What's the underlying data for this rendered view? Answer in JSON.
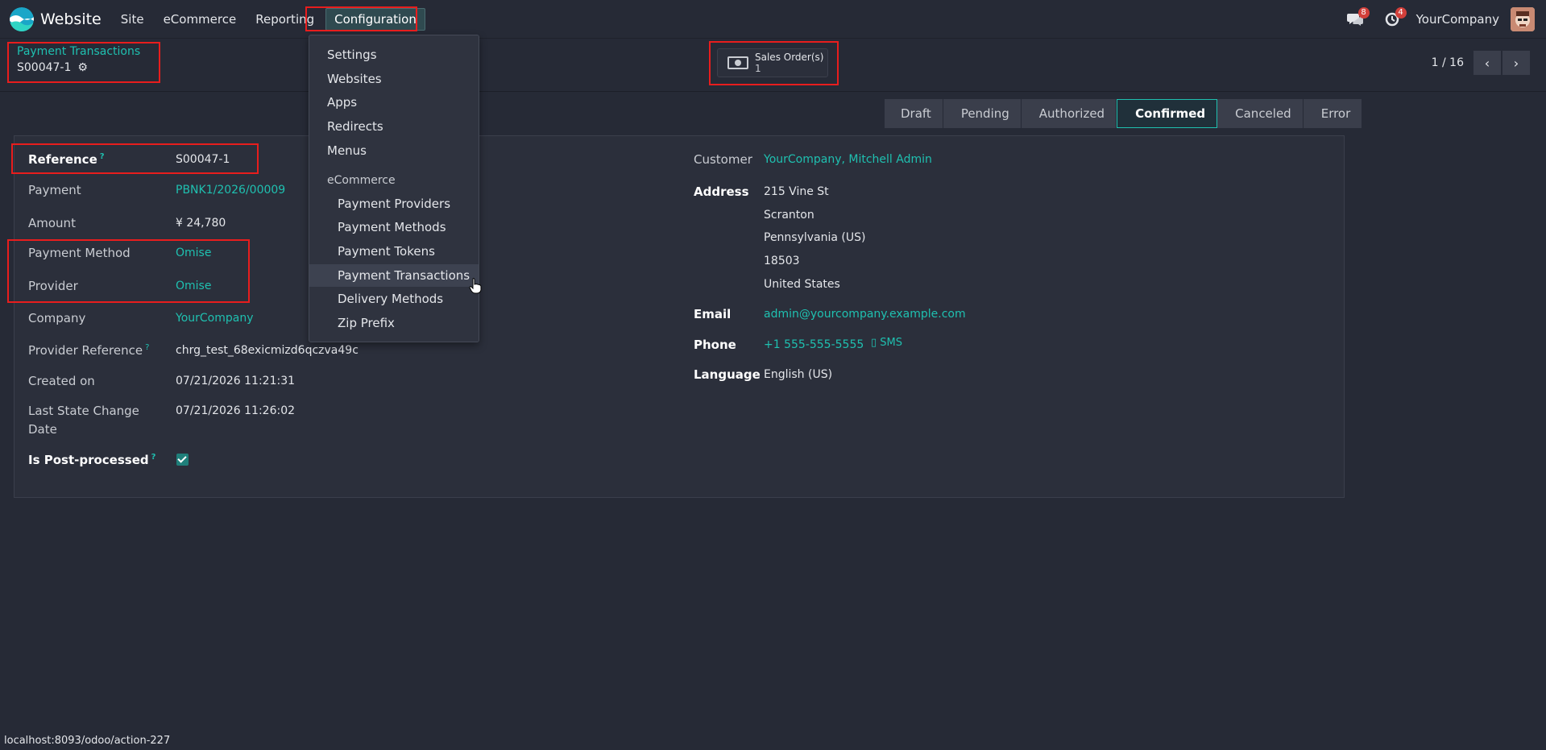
{
  "navbar": {
    "app_name": "Website",
    "menu": [
      "Site",
      "eCommerce",
      "Reporting",
      "Configuration"
    ],
    "messages_count": "8",
    "activities_count": "4",
    "company": "YourCompany"
  },
  "control_panel": {
    "breadcrumb_parent": "Payment Transactions",
    "breadcrumb_current": "S00047-1",
    "smart_button_label": "Sales Order(s)",
    "smart_button_value": "1",
    "pager": "1 / 16"
  },
  "statusbar": [
    "Draft",
    "Pending",
    "Authorized",
    "Confirmed",
    "Canceled",
    "Error"
  ],
  "form": {
    "reference_label": "Reference",
    "reference_value": "S00047-1",
    "payment_label": "Payment",
    "payment_value": "PBNK1/2026/00009",
    "amount_label": "Amount",
    "amount_value": "¥ 24,780",
    "payment_method_label": "Payment Method",
    "payment_method_value": "Omise",
    "provider_label": "Provider",
    "provider_value": "Omise",
    "company_label": "Company",
    "company_value": "YourCompany",
    "provider_ref_label": "Provider Reference",
    "provider_ref_value": "chrg_test_68exicmizd6qczva49c",
    "created_label": "Created on",
    "created_value": "07/21/2026 11:21:31",
    "last_state_label_1": "Last State Change",
    "last_state_label_2": "Date",
    "last_state_value": "07/21/2026 11:26:02",
    "post_processed_label": "Is Post-processed",
    "customer_label": "Customer",
    "customer_value": "YourCompany, Mitchell Admin",
    "address_label": "Address",
    "address_lines": [
      "215 Vine St",
      "Scranton",
      "Pennsylvania (US)",
      "18503",
      "United States"
    ],
    "email_label": "Email",
    "email_value": "admin@yourcompany.example.com",
    "phone_label": "Phone",
    "phone_value": "+1 555-555-5555",
    "sms_label": "SMS",
    "language_label": "Language",
    "language_value": "English (US)",
    "tooltip_mark": "?"
  },
  "dropdown": {
    "top_items": [
      "Settings",
      "Websites",
      "Apps",
      "Redirects",
      "Menus"
    ],
    "section_header": "eCommerce",
    "sub_items": [
      "Payment Providers",
      "Payment Methods",
      "Payment Tokens",
      "Payment Transactions",
      "Delivery Methods",
      "Zip Prefix"
    ]
  },
  "status_url": "localhost:8093/odoo/action-227",
  "colors": {
    "background": "#262a36",
    "accent": "#1fc0b0",
    "highlight_box": "#e81d1d"
  }
}
